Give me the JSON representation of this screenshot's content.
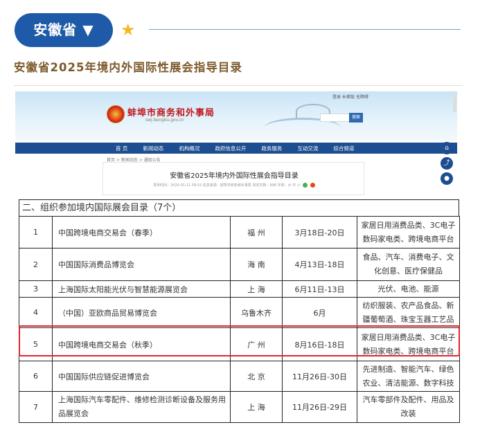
{
  "header": {
    "province": "安徽省",
    "dropdown_arrow": "▼",
    "star_icon": "star-icon",
    "title": "安徽省2025年境内外国际性展会指导目录"
  },
  "site": {
    "name": "蚌埠市商务和外事局",
    "url": "swj.bengbu.gov.cn",
    "top_links": "登录  长辈版  无障碍",
    "search_label": "搜索",
    "nav": [
      "首 页",
      "新闻动态",
      "机构概况",
      "政府信息公开",
      "政务服务",
      "互动交流",
      "综合频道"
    ],
    "breadcrumb": "首页 > 新闻动态 > 通知公告",
    "article_title": "安徽省2025年境内外国际性展会指导目录",
    "article_meta": "发布时间：2025-01-11 09:52   信息来源：蚌埠市商务和外事局   浏览次数：898   字体：大 中 小"
  },
  "colors": {
    "accent": "#1e5aa8",
    "title": "#7d5a2b",
    "highlight": "#e0262a",
    "nav_bar": "#1d4e91"
  },
  "table": {
    "section_title": "二、组织参加境内国际展会目录（7个）",
    "rows": [
      {
        "no": "1",
        "name": "中国跨境电商交易会（春季）",
        "city": "福 州",
        "date": "3月18日-20日",
        "category": "家居日用消费品类、3C电子数码家电类、跨境电商平台"
      },
      {
        "no": "2",
        "name": "中国国际消费品博览会",
        "city": "海 南",
        "date": "4月13日-18日",
        "category": "食品、汽车、消费电子、文化创意、医疗保健品"
      },
      {
        "no": "3",
        "name": "上海国际太阳能光伏与智慧能源展览会",
        "city": "上 海",
        "date": "6月11日-13日",
        "category": "光伏、电池、能源"
      },
      {
        "no": "4",
        "name": "（中国）亚欧商品贸易博览会",
        "city": "乌鲁木齐",
        "date": "6月",
        "category": "纺织服装、农产品食品、新疆葡萄酒、珠宝玉器工艺品"
      },
      {
        "no": "5",
        "name": "中国跨境电商交易会（秋季）",
        "city": "广 州",
        "date": "8月16日-18日",
        "category": "家居日用消费品类、3C电子数码家电类、跨境电商平台"
      },
      {
        "no": "6",
        "name": "中国国际供应链促进博览会",
        "city": "北 京",
        "date": "11月26日-30日",
        "category": "先进制造、智能汽车、绿色农业、清洁能源、数字科技"
      },
      {
        "no": "7",
        "name": "上海国际汽车零配件、维修检测诊断设备及服务用品展览会",
        "city": "上 海",
        "date": "11月26日-29日",
        "category": "汽车零部件及配件、用品及改装"
      }
    ]
  }
}
